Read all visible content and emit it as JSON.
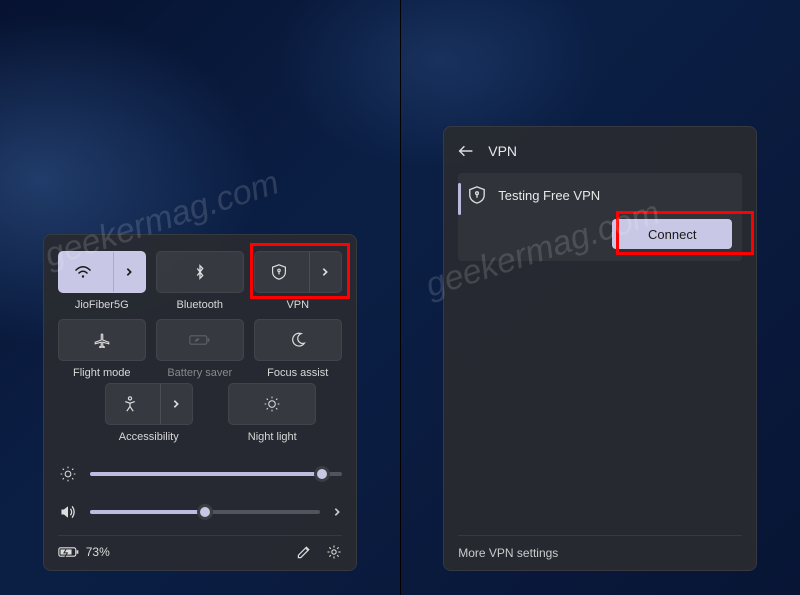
{
  "watermark": "geekermag.com",
  "quick_settings": {
    "tiles": {
      "wifi": {
        "label": "JioFiber5G"
      },
      "bluetooth": {
        "label": "Bluetooth"
      },
      "vpn": {
        "label": "VPN"
      },
      "flight": {
        "label": "Flight mode"
      },
      "battery": {
        "label": "Battery saver"
      },
      "focus": {
        "label": "Focus assist"
      },
      "accessibility": {
        "label": "Accessibility"
      },
      "nightlight": {
        "label": "Night light"
      }
    },
    "sliders": {
      "brightness": {
        "value": 92
      },
      "volume": {
        "value": 50
      }
    },
    "footer": {
      "battery_pct": "73%"
    }
  },
  "vpn_panel": {
    "title": "VPN",
    "item_name": "Testing Free VPN",
    "connect_label": "Connect",
    "more_link": "More VPN settings"
  }
}
